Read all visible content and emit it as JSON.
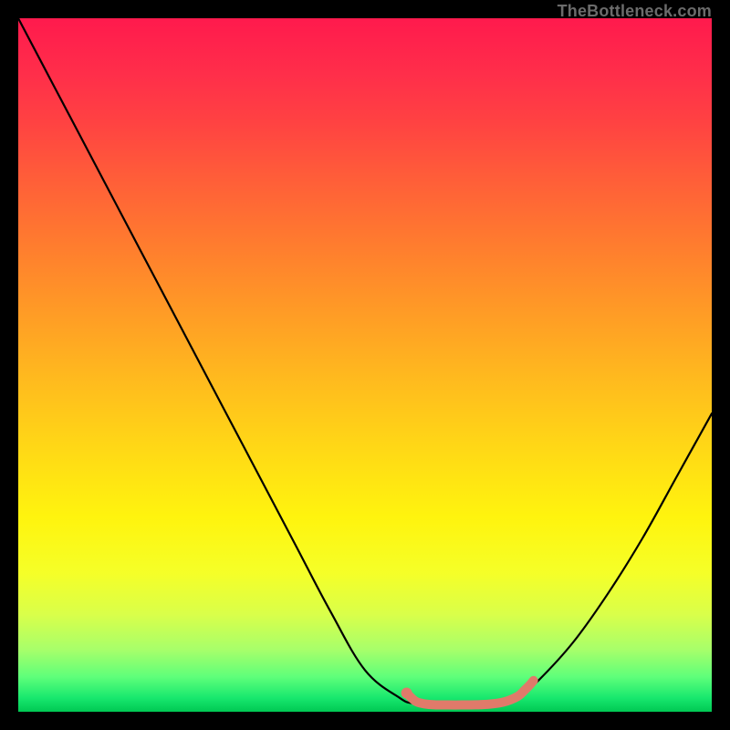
{
  "watermark": "TheBottleneck.com",
  "chart_data": {
    "type": "line",
    "title": "",
    "xlabel": "",
    "ylabel": "",
    "xlim": [
      0,
      100
    ],
    "ylim": [
      0,
      100
    ],
    "grid": false,
    "legend": false,
    "series": [
      {
        "name": "bottleneck-curve",
        "x": [
          0,
          5,
          10,
          15,
          20,
          25,
          30,
          35,
          40,
          45,
          50,
          55,
          57,
          60,
          63,
          66,
          70,
          73,
          75,
          80,
          85,
          90,
          95,
          100
        ],
        "y": [
          100,
          90.5,
          81,
          71.5,
          62,
          52.5,
          43,
          33.5,
          24,
          14.5,
          6,
          2,
          1.2,
          1,
          1,
          1,
          1.5,
          3,
          4.5,
          10,
          17,
          25,
          34,
          43
        ],
        "color": "#000000"
      },
      {
        "name": "optimal-range-marker",
        "x": [
          56,
          56.8,
          57.5,
          58.5,
          60,
          62,
          64,
          66,
          68,
          70,
          72,
          73,
          73.8,
          74.3
        ],
        "y": [
          2.7,
          1.9,
          1.4,
          1.15,
          1.0,
          0.98,
          0.98,
          1.0,
          1.1,
          1.4,
          2.2,
          3.1,
          3.9,
          4.5
        ],
        "color": "#e07a6a"
      }
    ],
    "markers": [
      {
        "name": "optimal-start-dot",
        "x": 56,
        "y": 2.7,
        "color": "#e07a6a",
        "size": 6
      }
    ]
  }
}
